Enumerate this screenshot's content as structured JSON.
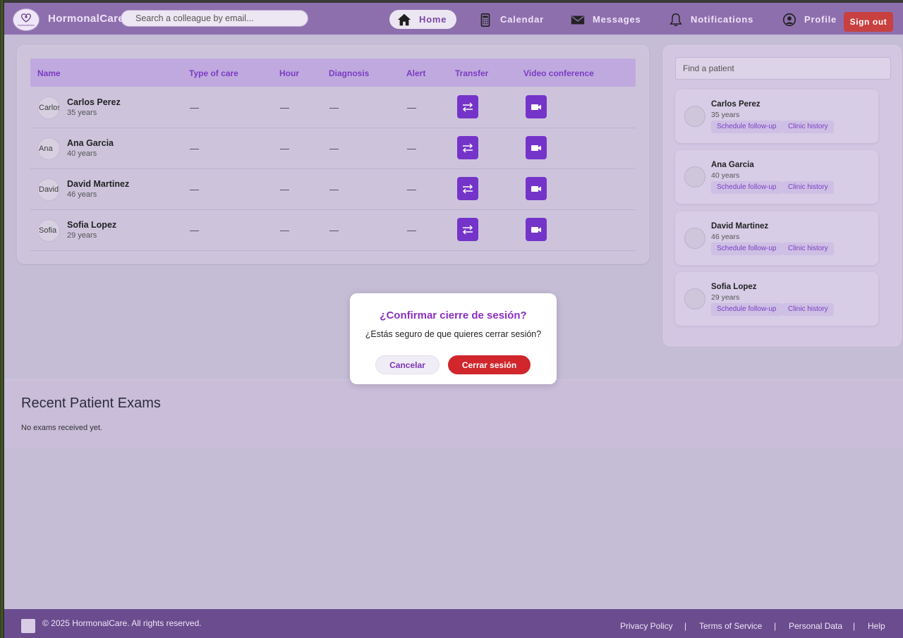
{
  "brand": {
    "name": "HormonalCare",
    "logo_text": "HormonalCare"
  },
  "search": {
    "placeholder": "Search a colleague by email..."
  },
  "nav": [
    {
      "label": "Home",
      "icon": "home-icon",
      "active": true
    },
    {
      "label": "Calendar",
      "icon": "calendar-icon",
      "active": false
    },
    {
      "label": "Messages",
      "icon": "envelope-icon",
      "active": false
    },
    {
      "label": "Notifications",
      "icon": "bell-icon",
      "active": false
    },
    {
      "label": "Profile",
      "icon": "user-circle-icon",
      "active": false
    }
  ],
  "signout_label": "Sign out",
  "table": {
    "headers": [
      "Name",
      "Type of care",
      "Hour",
      "Diagnosis",
      "Alert",
      "Transfer",
      "Video conference"
    ],
    "rows": [
      {
        "avatar_alt": "Carlos",
        "name": "Carlos Perez",
        "age": "35 years",
        "type": "—",
        "hour": "—",
        "diagnosis": "—",
        "alert": "—"
      },
      {
        "avatar_alt": "Ana",
        "name": "Ana Garcia",
        "age": "40 years",
        "type": "—",
        "hour": "—",
        "diagnosis": "—",
        "alert": "—"
      },
      {
        "avatar_alt": "David",
        "name": "David Martinez",
        "age": "46 years",
        "type": "—",
        "hour": "—",
        "diagnosis": "—",
        "alert": "—"
      },
      {
        "avatar_alt": "Sofia",
        "name": "Sofia Lopez",
        "age": "29 years",
        "type": "—",
        "hour": "—",
        "diagnosis": "—",
        "alert": "—"
      }
    ]
  },
  "sidebar": {
    "find_placeholder": "Find a patient",
    "patients": [
      {
        "name": "Carlos Perez",
        "age": "35 years",
        "followup": "Schedule follow-up",
        "history": "Clinic history"
      },
      {
        "name": "Ana Garcia",
        "age": "40 years",
        "followup": "Schedule follow-up",
        "history": "Clinic history"
      },
      {
        "name": "David Martinez",
        "age": "46 years",
        "followup": "Schedule follow-up",
        "history": "Clinic history"
      },
      {
        "name": "Sofia Lopez",
        "age": "29 years",
        "followup": "Schedule follow-up",
        "history": "Clinic history"
      }
    ]
  },
  "exams": {
    "title": "Recent Patient Exams",
    "empty": "No exams received yet."
  },
  "modal": {
    "title": "¿Confirmar cierre de sesión?",
    "text": "¿Estás seguro de que quieres cerrar sesión?",
    "cancel": "Cancelar",
    "confirm": "Cerrar sesión"
  },
  "footer": {
    "copyright": "© 2025 HormonalCare. All rights reserved.",
    "links": [
      "Privacy Policy",
      "Terms of Service",
      "Personal Data",
      "Help"
    ],
    "separator": "|"
  },
  "colors": {
    "accent": "#7534c9",
    "navbar": "#8e6fae",
    "danger": "#d0262c",
    "footer": "#6b4c8f"
  }
}
